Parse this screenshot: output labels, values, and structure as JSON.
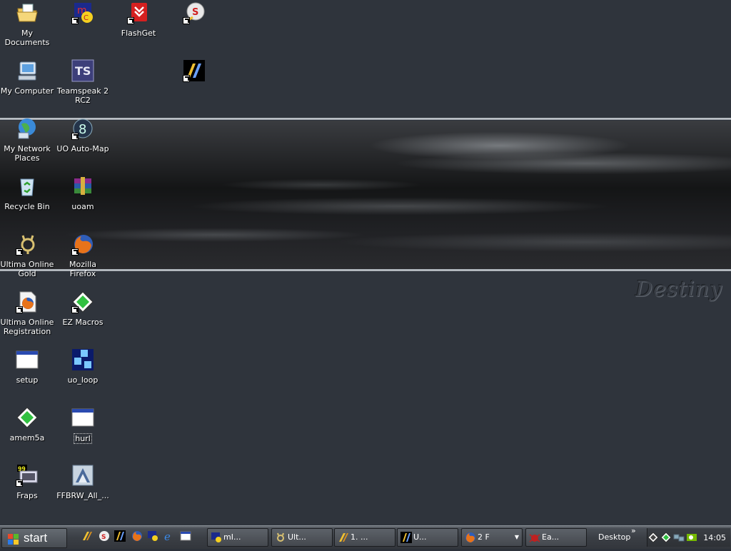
{
  "wallpaper": {
    "logo_text": "Destiny"
  },
  "desktop_icons": [
    {
      "id": "my-documents",
      "label": "My Documents"
    },
    {
      "id": "mirc",
      "label": ""
    },
    {
      "id": "flashget",
      "label": "FlashGet"
    },
    {
      "id": "speedshortcut",
      "label": ""
    },
    {
      "id": "my-computer",
      "label": "My Computer"
    },
    {
      "id": "teamspeak",
      "label": "Teamspeak 2 RC2"
    },
    {
      "id": "blue-shortcut",
      "label": ""
    },
    {
      "id": "network-places",
      "label": "My Network Places"
    },
    {
      "id": "uo-automap",
      "label": "UO Auto-Map"
    },
    {
      "id": "recycle-bin",
      "label": "Recycle Bin"
    },
    {
      "id": "uoam",
      "label": "uoam"
    },
    {
      "id": "uo-gold",
      "label": "Ultima Online Gold"
    },
    {
      "id": "firefox",
      "label": "Mozilla Firefox"
    },
    {
      "id": "uo-registration",
      "label": "Ultima Online Registration"
    },
    {
      "id": "ez-macros",
      "label": "EZ Macros"
    },
    {
      "id": "setup",
      "label": "setup"
    },
    {
      "id": "uo-loop",
      "label": "uo_loop"
    },
    {
      "id": "amem5a",
      "label": "amem5a"
    },
    {
      "id": "hurl",
      "label": "hurl"
    },
    {
      "id": "fraps",
      "label": "Fraps"
    },
    {
      "id": "ffbrw",
      "label": "FFBRW_All_..."
    }
  ],
  "taskbar": {
    "start_label": "start",
    "quick_launch": [
      "ultima-icon",
      "speed-icon",
      "blue-app-icon",
      "firefox-icon",
      "mirc-icon",
      "ie-icon",
      "window-icon"
    ],
    "tasks": [
      {
        "label": "mI...",
        "icon": "mirc-icon"
      },
      {
        "label": "Ult...",
        "icon": "uo-gold-icon"
      },
      {
        "label": "1. ...",
        "icon": "ultima-icon"
      },
      {
        "label": "U...",
        "icon": "blue-app-icon"
      },
      {
        "label": "2 F",
        "icon": "firefox-icon"
      },
      {
        "label": "Ea...",
        "icon": "spider-icon"
      }
    ],
    "desktop_toolbar_label": "Desktop",
    "chevron": "»",
    "clock": "14:05"
  },
  "colors": {
    "background": "#2d323a",
    "taskbar": "#3b3f45",
    "wallpaper_band": "#1a1b1d"
  }
}
